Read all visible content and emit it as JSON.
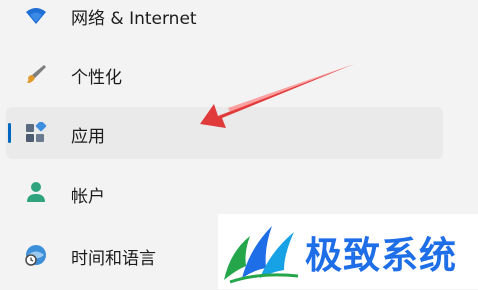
{
  "nav": {
    "items": [
      {
        "label": "网络 & Internet",
        "icon": "wifi-icon"
      },
      {
        "label": "个性化",
        "icon": "brush-icon"
      },
      {
        "label": "应用",
        "icon": "apps-icon",
        "selected": true
      },
      {
        "label": "帐户",
        "icon": "person-icon"
      },
      {
        "label": "时间和语言",
        "icon": "globe-clock-icon"
      }
    ]
  },
  "annotation": {
    "arrow_color": "#e03a3a"
  },
  "watermark": {
    "text": "极致系统",
    "color": "#1e6ee8",
    "logo": "green-blue-swoosh-logo"
  },
  "accent": "#0067c0"
}
